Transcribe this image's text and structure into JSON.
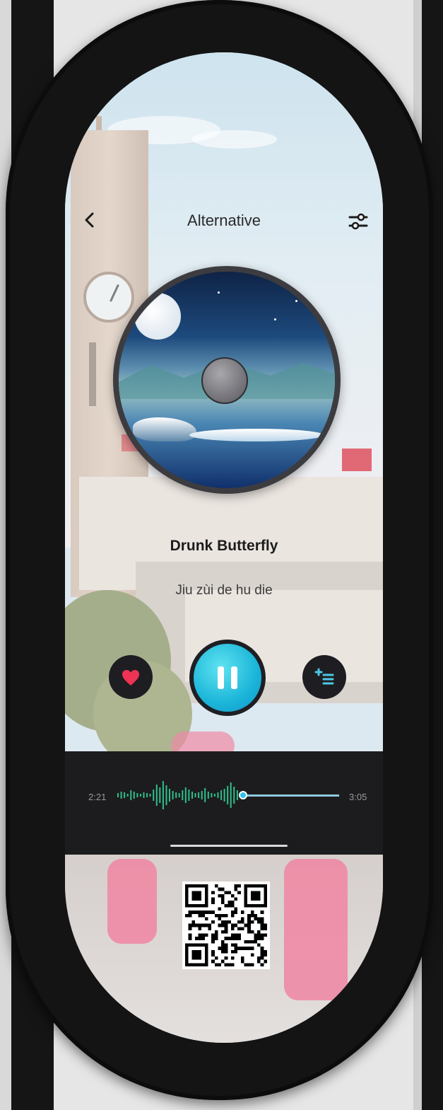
{
  "header": {
    "title": "Alternative",
    "back_icon": "chevron-left-icon",
    "settings_icon": "sliders-icon"
  },
  "now_playing": {
    "title": "Drunk Butterfly",
    "subtitle": "Jiu zùi de hu die"
  },
  "controls": {
    "like_icon": "heart-icon",
    "play_state": "playing",
    "pause_icon": "pause-icon",
    "queue_icon": "add-to-queue-icon"
  },
  "progress": {
    "current_time": "2:21",
    "total_time": "3:05",
    "fraction": 0.76
  },
  "colors": {
    "accent": "#1bb5d9",
    "waveform": "#2fbf8a",
    "heart": "#ee3355",
    "panel": "#1c1c1e"
  },
  "qr_icon": "qr-code-icon"
}
